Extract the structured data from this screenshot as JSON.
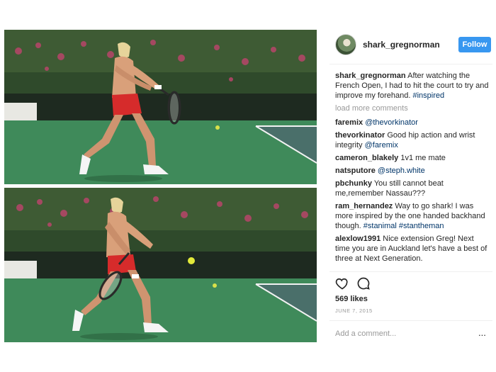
{
  "post": {
    "username": "shark_gregnorman",
    "follow_label": "Follow",
    "caption": {
      "user": "shark_gregnorman",
      "text": "After watching the French Open, I had to hit the court to try and improve my forehand.",
      "hashtag": "#inspired"
    },
    "load_more": "load more comments",
    "comments": [
      {
        "user": "faremix",
        "text": "",
        "mention": "@thevorkinator"
      },
      {
        "user": "thevorkinator",
        "text": "Good hip action and wrist integrity",
        "mention": "@faremix"
      },
      {
        "user": "cameron_blakely",
        "text": "1v1 me mate",
        "mention": ""
      },
      {
        "user": "natsputore",
        "text": "",
        "mention": "@steph.white"
      },
      {
        "user": "pbchunky",
        "text": "You still cannot beat me,remember Nassau???",
        "mention": ""
      },
      {
        "user": "ram_hernandez",
        "text": "Way to go shark! I was more inspired by the one handed backhand though.",
        "mention": "#stanimal #stantheman"
      },
      {
        "user": "alexlow1991",
        "text": "Nice extension Greg! Next time you are in Auckland let's have a best of three at Next Generation.",
        "mention": ""
      }
    ],
    "likes": "569 likes",
    "date": "JUNE 7, 2015",
    "add_comment_placeholder": "Add a comment...",
    "more_label": "..."
  },
  "icons": {
    "like": "heart-icon",
    "comment": "comment-icon",
    "avatar": "avatar",
    "more": "more-options-icon"
  },
  "colors": {
    "follow_blue": "#3897f0",
    "mention_blue": "#003569",
    "muted_gray": "#999999",
    "court_green": "#3f8a5a"
  }
}
